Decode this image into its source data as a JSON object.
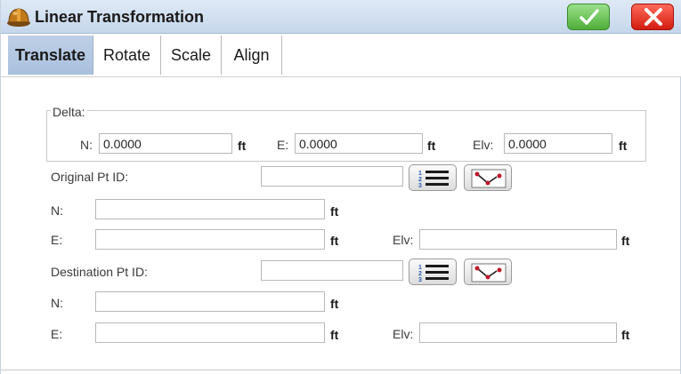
{
  "window": {
    "title": "Linear Transformation"
  },
  "header": {
    "ok_icon": "checkmark-icon",
    "cancel_icon": "close-icon",
    "app_icon": "hardhat-icon"
  },
  "tabs": [
    {
      "label": "Translate",
      "active": true
    },
    {
      "label": "Rotate",
      "active": false
    },
    {
      "label": "Scale",
      "active": false
    },
    {
      "label": "Align",
      "active": false
    }
  ],
  "delta": {
    "group_label": "Delta:",
    "n_label": "N:",
    "n_value": "0.0000",
    "n_unit": "ft",
    "e_label": "E:",
    "e_value": "0.0000",
    "e_unit": "ft",
    "elv_label": "Elv:",
    "elv_value": "0.0000",
    "elv_unit": "ft"
  },
  "original": {
    "pt_label": "Original Pt ID:",
    "pt_value": "",
    "n_label": "N:",
    "n_value": "",
    "n_unit": "ft",
    "e_label": "E:",
    "e_value": "",
    "e_unit": "ft",
    "elv_label": "Elv:",
    "elv_value": "",
    "elv_unit": "ft"
  },
  "destination": {
    "pt_label": "Destination Pt ID:",
    "pt_value": "",
    "n_label": "N:",
    "n_value": "",
    "n_unit": "ft",
    "e_label": "E:",
    "e_value": "",
    "e_unit": "ft",
    "elv_label": "Elv:",
    "elv_value": "",
    "elv_unit": "ft"
  },
  "colors": {
    "accent": "#a9c0dd",
    "ok": "#4fae3a",
    "cancel": "#d21c10"
  }
}
